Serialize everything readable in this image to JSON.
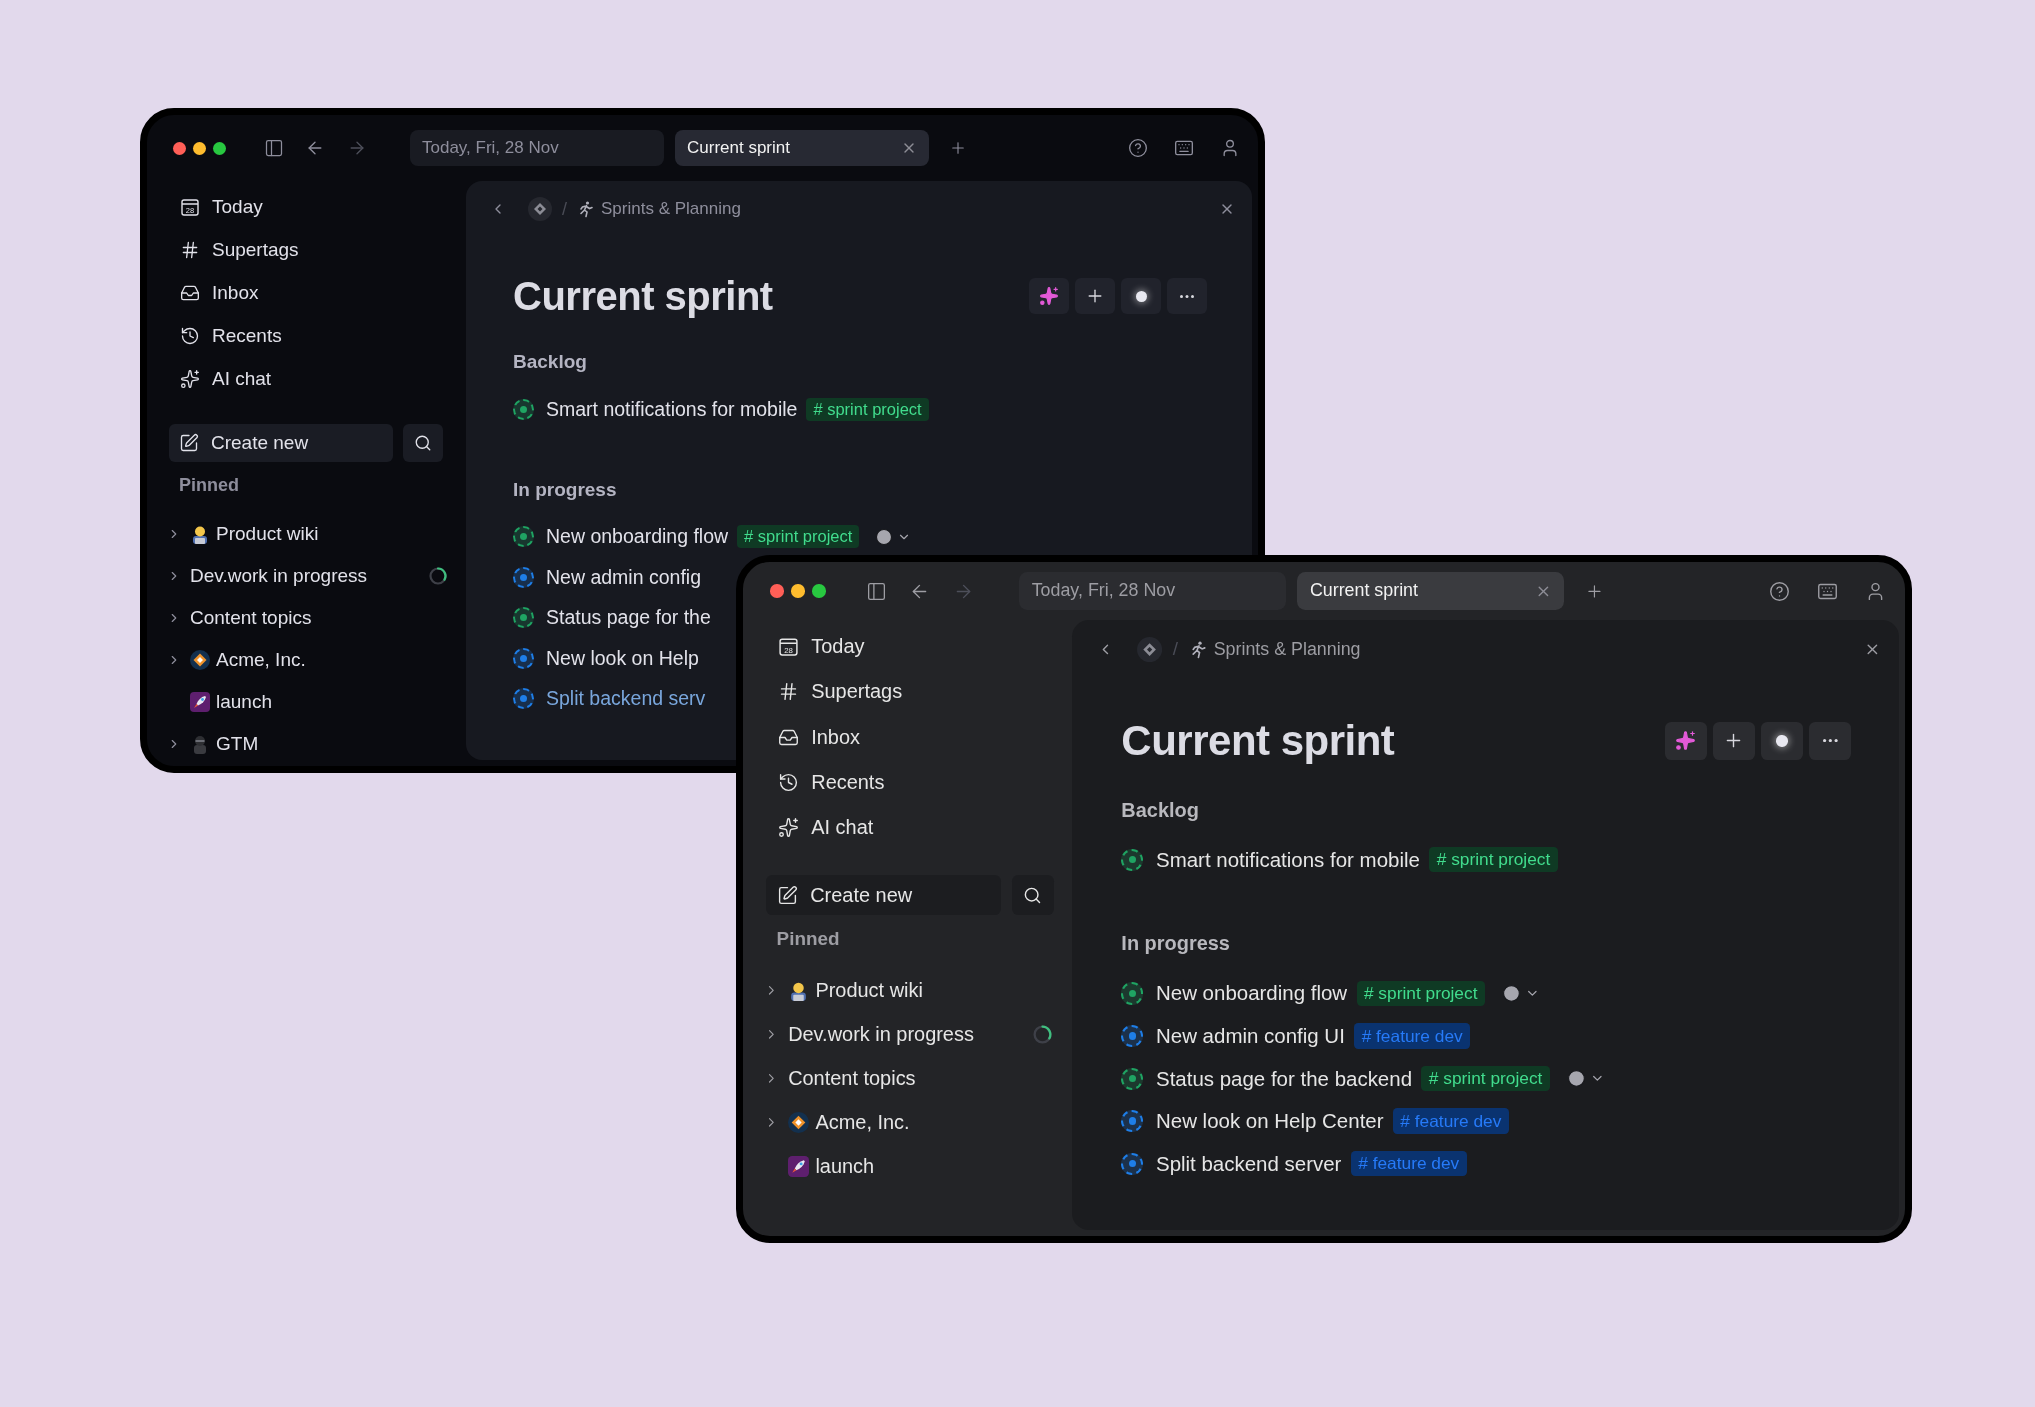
{
  "windows": [
    {
      "kind": "dark",
      "tabs": [
        {
          "label": "Today, Fri, 28 Nov",
          "selected": false
        },
        {
          "label": "Current sprint",
          "selected": true
        }
      ],
      "nav": [
        {
          "label": "Today",
          "icon_text": "28"
        },
        {
          "label": "Supertags"
        },
        {
          "label": "Inbox"
        },
        {
          "label": "Recents"
        },
        {
          "label": "AI chat"
        }
      ],
      "create_button": "Create new",
      "pinned_heading": "Pinned",
      "pinned": [
        {
          "label": "Product wiki",
          "kind": "person",
          "expandable": true,
          "syncing": false
        },
        {
          "label": "Dev.work in progress",
          "kind": "none",
          "expandable": true,
          "syncing": true
        },
        {
          "label": "Content topics",
          "kind": "none",
          "expandable": true,
          "syncing": false
        },
        {
          "label": "Acme, Inc.",
          "kind": "logo",
          "expandable": true,
          "syncing": false
        },
        {
          "label": "launch",
          "kind": "rocket",
          "expandable": false,
          "syncing": false
        },
        {
          "label": "GTM",
          "kind": "figure",
          "expandable": true,
          "syncing": false
        }
      ],
      "breadcrumb": {
        "separator": "/",
        "page": "Sprints & Planning"
      },
      "title": "Current sprint",
      "sections": [
        {
          "heading": "Backlog",
          "items": [
            {
              "label": "Smart notifications for mobile",
              "color": "#1fa463",
              "tag": {
                "label": "# sprint project",
                "color": "#0f3a24"
              },
              "shared": false,
              "highlighted": false
            }
          ]
        },
        {
          "heading": "In progress",
          "items": [
            {
              "label": "New onboarding flow",
              "color": "#1fa463",
              "tag": {
                "label": "# sprint project",
                "color": "#0f3a24"
              },
              "shared": true,
              "highlighted": false
            },
            {
              "label": "New admin config",
              "color": "#1e7ee8",
              "shared": false,
              "highlighted": false
            },
            {
              "label": "Status page for the",
              "color": "#1fa463",
              "shared": false,
              "highlighted": false
            },
            {
              "label": "New look on Help",
              "color": "#1e7ee8",
              "shared": false,
              "highlighted": false
            },
            {
              "label": "Split backend serv",
              "color": "#1e7ee8",
              "shared": false,
              "highlighted": true
            }
          ]
        }
      ]
    },
    {
      "kind": "dim",
      "tabs": [
        {
          "label": "Today, Fri, 28 Nov",
          "selected": false
        },
        {
          "label": "Current sprint",
          "selected": true
        }
      ],
      "nav": [
        {
          "label": "Today",
          "icon_text": "28"
        },
        {
          "label": "Supertags"
        },
        {
          "label": "Inbox"
        },
        {
          "label": "Recents"
        },
        {
          "label": "AI chat"
        }
      ],
      "create_button": "Create new",
      "pinned_heading": "Pinned",
      "pinned": [
        {
          "label": "Product wiki",
          "kind": "person",
          "expandable": true,
          "syncing": false
        },
        {
          "label": "Dev.work in progress",
          "kind": "none",
          "expandable": true,
          "syncing": true
        },
        {
          "label": "Content topics",
          "kind": "none",
          "expandable": true,
          "syncing": false
        },
        {
          "label": "Acme, Inc.",
          "kind": "logo",
          "expandable": true,
          "syncing": false
        },
        {
          "label": "launch",
          "kind": "rocket",
          "expandable": false,
          "syncing": false
        }
      ],
      "breadcrumb": {
        "separator": "/",
        "page": "Sprints & Planning"
      },
      "title": "Current sprint",
      "sections": [
        {
          "heading": "Backlog",
          "items": [
            {
              "label": "Smart notifications for mobile",
              "color": "#1fa463",
              "tag": {
                "label": "# sprint project",
                "color": "#0f3a24"
              },
              "shared": false,
              "highlighted": false
            }
          ]
        },
        {
          "heading": "In progress",
          "items": [
            {
              "label": "New onboarding flow",
              "color": "#1fa463",
              "tag": {
                "label": "# sprint project",
                "color": "#0f3a24"
              },
              "shared": true,
              "highlighted": false
            },
            {
              "label": "New admin config UI",
              "color": "#1e7ee8",
              "tag": {
                "label": "# feature dev",
                "color": "#0a3370"
              },
              "shared": false,
              "highlighted": false
            },
            {
              "label": "Status page for the backend",
              "color": "#1fa463",
              "tag": {
                "label": "# sprint project",
                "color": "#0f3a24"
              },
              "shared": true,
              "highlighted": false
            },
            {
              "label": "New look on Help Center",
              "color": "#1e7ee8",
              "tag": {
                "label": "# feature dev",
                "color": "#0a3370"
              },
              "shared": false,
              "highlighted": false
            },
            {
              "label": "Split backend server",
              "color": "#1e7ee8",
              "tag": {
                "label": "# feature dev",
                "color": "#0a3370"
              },
              "shared": false,
              "highlighted": false
            }
          ]
        }
      ]
    }
  ]
}
